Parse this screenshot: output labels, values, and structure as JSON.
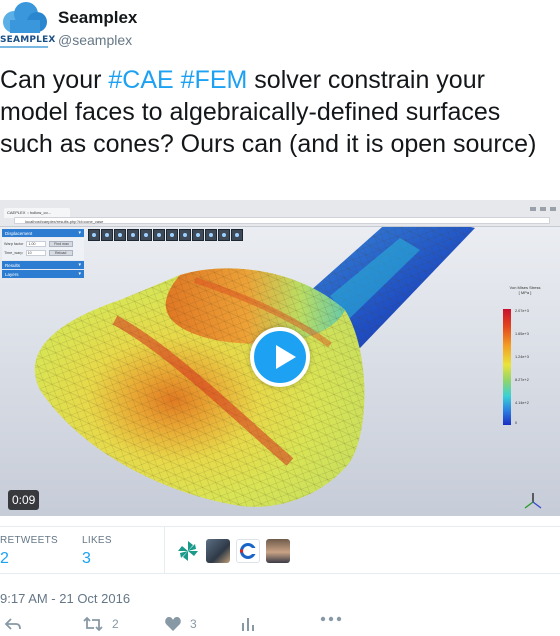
{
  "account": {
    "display_name": "Seamplex",
    "handle": "@seamplex",
    "logo_text": "SEAMPLEX"
  },
  "tweet": {
    "text_before": "Can your ",
    "hashtag1": "#CAE",
    "text_space": " ",
    "hashtag2": "#FEM",
    "text_after": " solver constrain your model faces to algebraically-defined surfaces such as cones? Ours can (and it is open source)"
  },
  "media": {
    "duration": "0:09",
    "browser_tab": "CAEPLEX :: hollow_co...",
    "browser_url": "localhost/caeplex/results.php?id=cone_vase",
    "panels": {
      "displacement": "Displacement",
      "warp_factor_label": "Warp factor",
      "warp_factor_value": "1.00",
      "find_max_label": "Find max",
      "time_warp_label": "Time_warp",
      "time_warp_value": "10",
      "reload_label": "Reload",
      "results": "Results",
      "layers": "Layers"
    },
    "legend": {
      "title": "Von Mises Stress",
      "unit": "[ MPa ]",
      "labels": [
        "2.07e+3",
        "1.65e+3",
        "1.24e+3",
        "8.27e+2",
        "4.14e+2",
        "0"
      ]
    },
    "icons": [
      "play-icon",
      "axis-triad-icon"
    ]
  },
  "stats": {
    "retweets_label": "RETWEETS",
    "retweets_count": "2",
    "likes_label": "LIKES",
    "likes_count": "3"
  },
  "timestamp": "9:17 AM - 21 Oct 2016",
  "actions": {
    "reply_icon": "reply-icon",
    "retweet_count": "2",
    "like_count": "3",
    "analytics_icon": "analytics-icon",
    "more_icon": "more-icon"
  },
  "colors": {
    "accent": "#1da1f2",
    "muted": "#657786",
    "brand": "#1a4e86"
  }
}
